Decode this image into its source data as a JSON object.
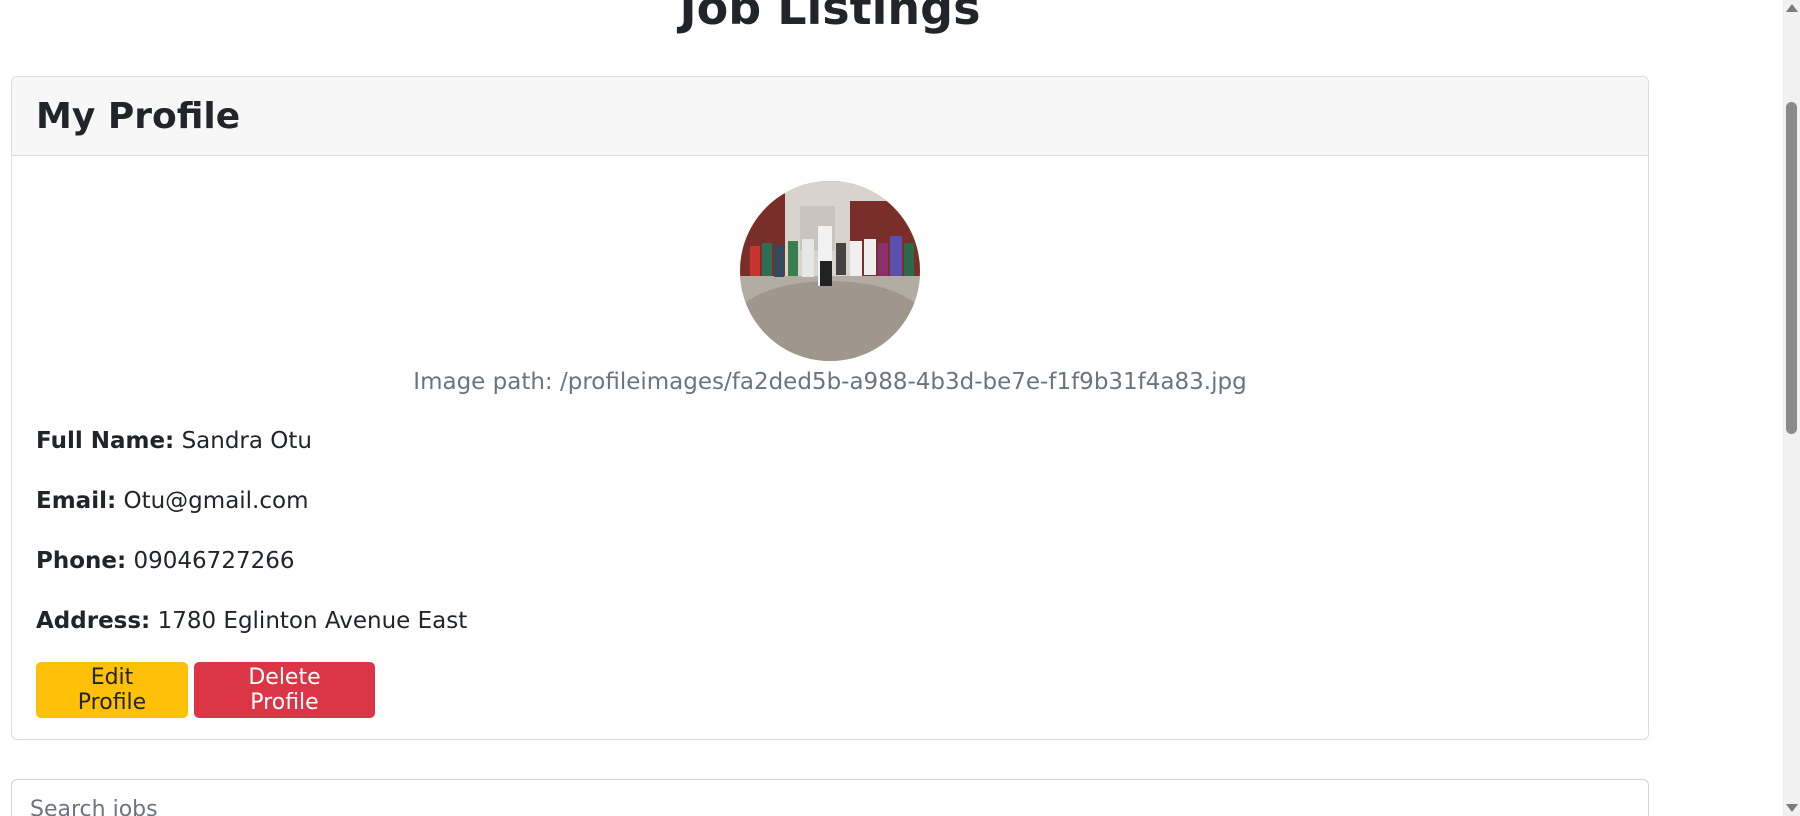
{
  "page": {
    "title": "Job Listings"
  },
  "profile": {
    "header": "My Profile",
    "image_path_text": "Image path: /profileimages/fa2ded5b-a988-4b3d-be7e-f1f9b31f4a83.jpg",
    "fields": {
      "full_name_label": "Full Name:",
      "full_name_value": "Sandra Otu",
      "email_label": "Email:",
      "email_value": "Otu@gmail.com",
      "phone_label": "Phone:",
      "phone_value": "09046727266",
      "address_label": "Address:",
      "address_value": "1780 Eglinton Avenue East"
    },
    "buttons": {
      "edit_label": "Edit Profile",
      "delete_label": "Delete Profile"
    }
  },
  "search": {
    "placeholder": "Search jobs",
    "value": ""
  },
  "colors": {
    "edit_button": "#ffc107",
    "delete_button": "#dc3545",
    "muted_text": "#6c757d"
  }
}
